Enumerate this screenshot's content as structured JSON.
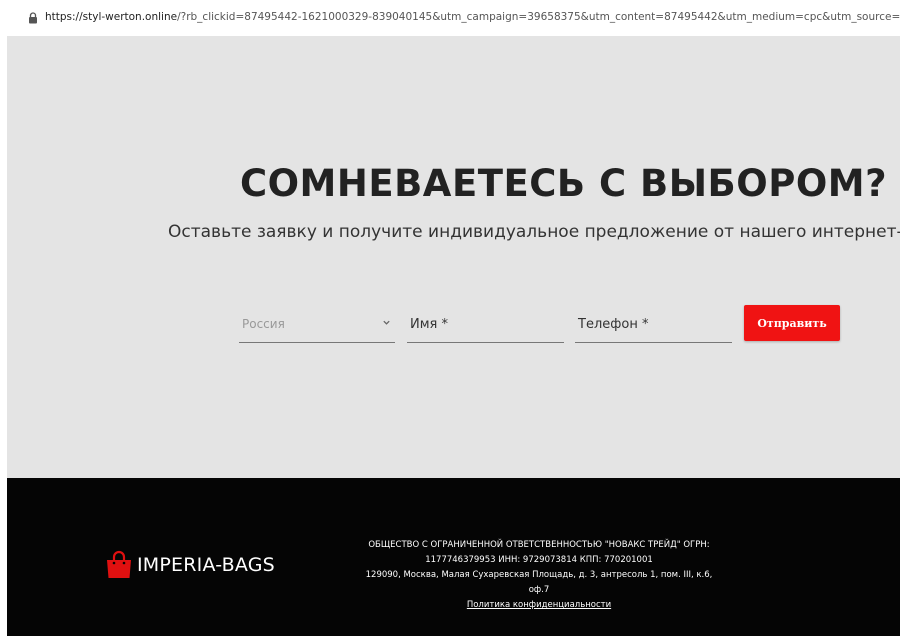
{
  "browser": {
    "url_host": "https://styl-werton.online",
    "url_rest": "/?rb_clickid=87495442-1621000329-839040145&utm_campaign=39658375&utm_content=87495442&utm_medium=cpc&utm_source=mytarget#b"
  },
  "hero": {
    "title": "СОМНЕВАЕТЕСЬ С ВЫБОРОМ?",
    "subtitle": "Оставьте заявку и получите индивидуальное предложение от нашего интернет-мага"
  },
  "form": {
    "country_value": "Россия",
    "name_placeholder": "Имя *",
    "phone_placeholder": "Телефон *",
    "submit_label": "Отправить"
  },
  "footer": {
    "logo_text": "IMPERIA-BAGS",
    "company_line1": "ОБЩЕСТВО С ОГРАНИЧЕННОЙ ОТВЕТСТВЕННОСТЬЮ \"НОВАКС ТРЕЙД\" ОГРН:",
    "company_line2": "1177746379953 ИНН: 9729073814 КПП: 770201001",
    "company_line3": "129090, Москва, Малая Сухаревская Площадь, д. 3, антресоль 1, пом. III, к.6,",
    "company_line4": "оф.7",
    "privacy_link": "Политика конфиденциальности"
  },
  "colors": {
    "accent": "#f01313",
    "hero_bg": "#e4e4e4",
    "footer_bg": "#050505"
  },
  "icons": [
    "lock-icon",
    "chevron-down-icon",
    "bag-icon"
  ]
}
